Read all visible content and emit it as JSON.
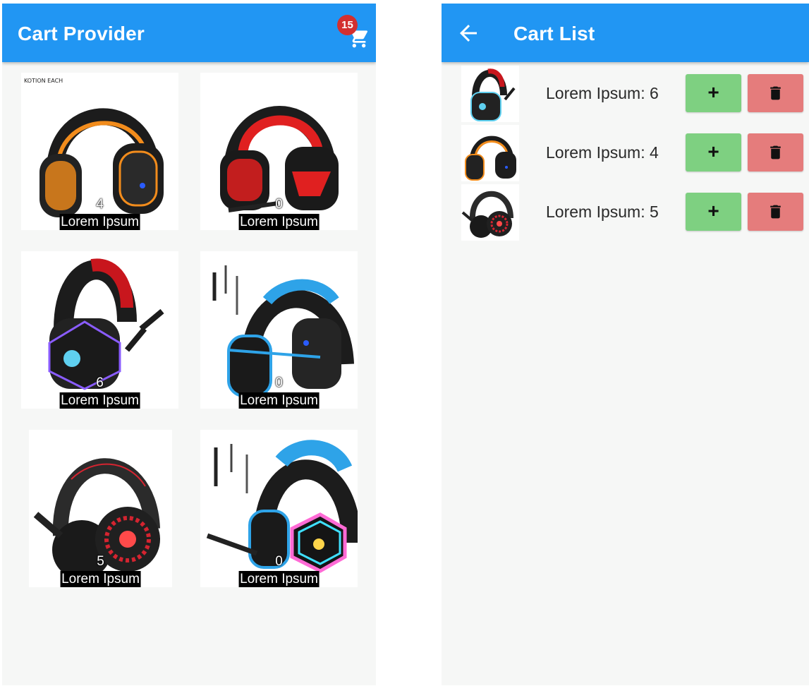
{
  "provider": {
    "title": "Cart Provider",
    "cart_icon": "cart-icon",
    "cart_count": "15",
    "products": [
      {
        "count": "4",
        "label": "Lorem Ipsum",
        "accent": "#f28c1c"
      },
      {
        "count": "0",
        "label": "Lorem Ipsum",
        "accent": "#e02020"
      },
      {
        "count": "6",
        "label": "Lorem Ipsum",
        "accent": "#c8161d"
      },
      {
        "count": "0",
        "label": "Lorem Ipsum",
        "accent": "#2ea3e8"
      },
      {
        "count": "5",
        "label": "Lorem Ipsum",
        "accent": "#d42430"
      },
      {
        "count": "0",
        "label": "Lorem Ipsum",
        "accent": "#2ea3e8"
      }
    ]
  },
  "cart_list": {
    "title": "Cart List",
    "back_icon": "arrow-back-icon",
    "add_label": "+",
    "delete_icon": "trash-icon",
    "items": [
      {
        "text": "Lorem Ipsum: 6",
        "accent": "#c8161d"
      },
      {
        "text": "Lorem Ipsum: 4",
        "accent": "#f28c1c"
      },
      {
        "text": "Lorem Ipsum: 5",
        "accent": "#d42430"
      }
    ]
  },
  "colors": {
    "app_bar": "#2196f3",
    "badge": "#d32f2f",
    "add_button": "#7ed081",
    "delete_button": "#e57c7c",
    "background": "#f6f7f6"
  }
}
